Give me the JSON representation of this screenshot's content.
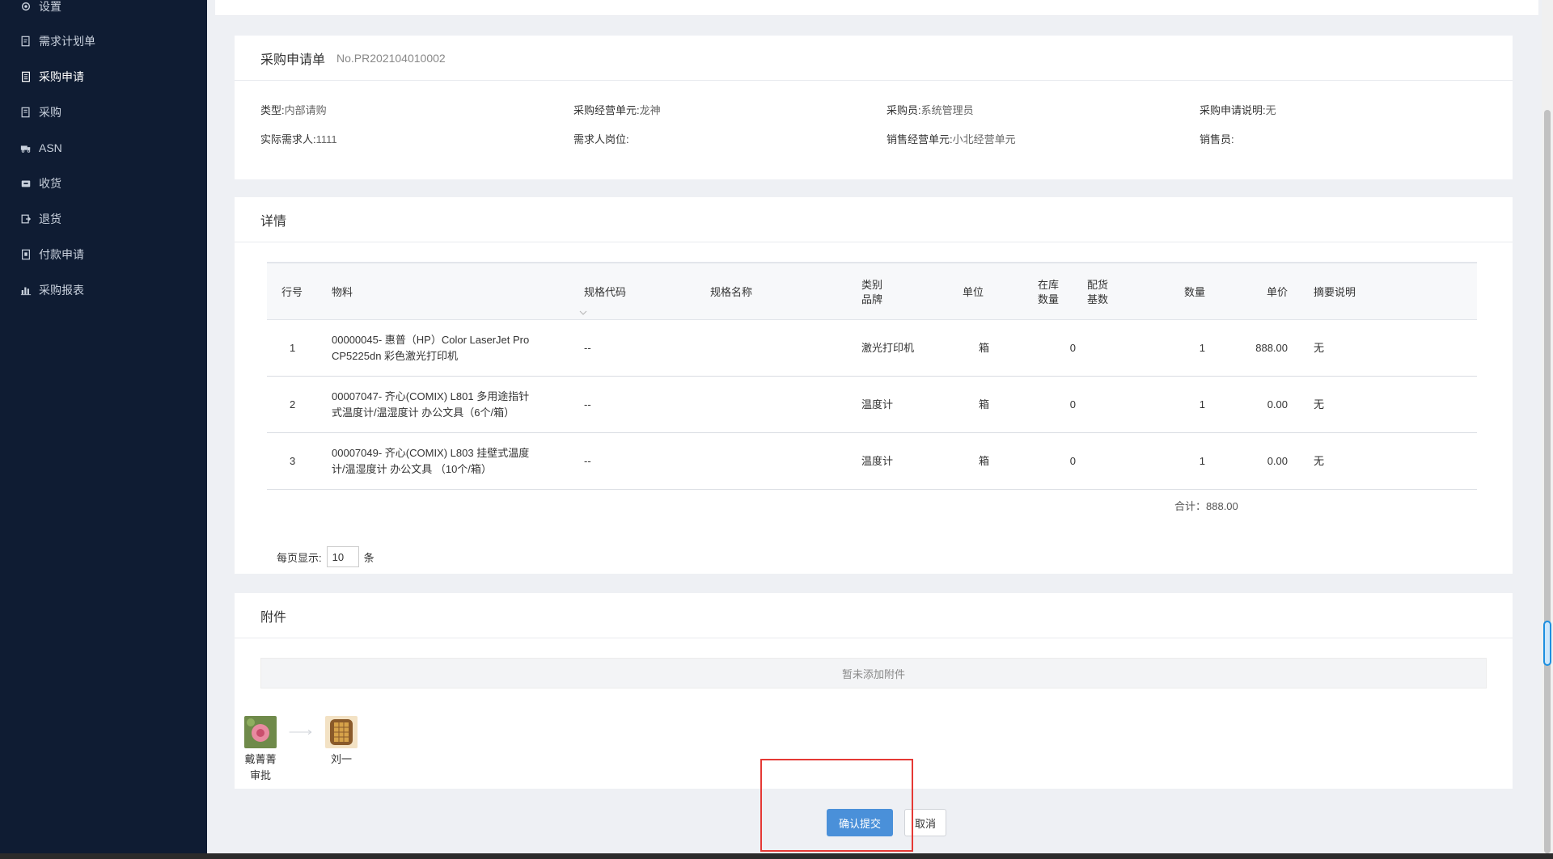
{
  "sidebar": {
    "items": [
      {
        "label": "设置",
        "icon": "gear-icon"
      },
      {
        "label": "需求计划单",
        "icon": "document-edit-icon"
      },
      {
        "label": "采购申请",
        "icon": "clipboard-icon",
        "active": true
      },
      {
        "label": "采购",
        "icon": "list-icon"
      },
      {
        "label": "ASN",
        "icon": "truck-icon"
      },
      {
        "label": "收货",
        "icon": "inbox-icon"
      },
      {
        "label": "退货",
        "icon": "return-icon"
      },
      {
        "label": "付款申请",
        "icon": "payment-icon"
      },
      {
        "label": "采购报表",
        "icon": "bar-chart-icon"
      }
    ]
  },
  "header_panel": {
    "title": "采购申请单",
    "number": "No.PR202104010002",
    "fields": {
      "type_label": "类型:",
      "type_value": "内部请购",
      "unit_label": "采购经营单元:",
      "unit_value": "龙神",
      "buyer_label": "采购员:",
      "buyer_value": "系统管理员",
      "desc_label": "采购申请说明:",
      "desc_value": "无",
      "requester_label": "实际需求人:",
      "requester_value": "1111",
      "position_label": "需求人岗位:",
      "position_value": "",
      "sales_unit_label": "销售经营单元:",
      "sales_unit_value": "小北经营单元",
      "salesman_label": "销售员:",
      "salesman_value": ""
    }
  },
  "details_panel": {
    "title": "详情",
    "columns": {
      "line": "行号",
      "material": "物料",
      "spec_code": "规格代码",
      "spec_name": "规格名称",
      "category_1": "类别",
      "category_2": "品牌",
      "unit": "单位",
      "stock_1": "在库",
      "stock_2": "数量",
      "alloc_1": "配货",
      "alloc_2": "基数",
      "qty": "数量",
      "price": "单价",
      "remark": "摘要说明"
    },
    "rows": [
      {
        "line": "1",
        "material_1": "00000045- 惠普（HP）Color LaserJet Pro",
        "material_2": "CP5225dn 彩色激光打印机",
        "spec_code": "--",
        "spec_name": "",
        "category": "激光打印机",
        "unit": "箱",
        "stock": "0",
        "alloc": "",
        "qty": "1",
        "price": "888.00",
        "remark": "无"
      },
      {
        "line": "2",
        "material_1": "00007047- 齐心(COMIX) L801 多用途指针",
        "material_2": "式温度计/温湿度计 办公文具（6个/箱）",
        "spec_code": "--",
        "spec_name": "",
        "category": "温度计",
        "unit": "箱",
        "stock": "0",
        "alloc": "",
        "qty": "1",
        "price": "0.00",
        "remark": "无"
      },
      {
        "line": "3",
        "material_1": "00007049- 齐心(COMIX) L803 挂壁式温度",
        "material_2": "计/温湿度计 办公文具 （10个/箱）",
        "spec_code": "--",
        "spec_name": "",
        "category": "温度计",
        "unit": "箱",
        "stock": "0",
        "alloc": "",
        "qty": "1",
        "price": "0.00",
        "remark": "无"
      }
    ],
    "total": "合计：888.00",
    "pager_prefix": "每页显示:",
    "pager_value": "10",
    "pager_suffix": "条"
  },
  "attachments_panel": {
    "title": "附件",
    "empty_text": "暂未添加附件",
    "flow": [
      {
        "name": "戴菁菁",
        "role": "审批"
      },
      {
        "name": "刘一",
        "role": ""
      }
    ]
  },
  "actions": {
    "confirm_label": "确认提交",
    "cancel_label": "取消"
  },
  "colors": {
    "sidebar_bg": "#0f1c33",
    "primary": "#4a90d9",
    "highlight": "#e53935"
  }
}
